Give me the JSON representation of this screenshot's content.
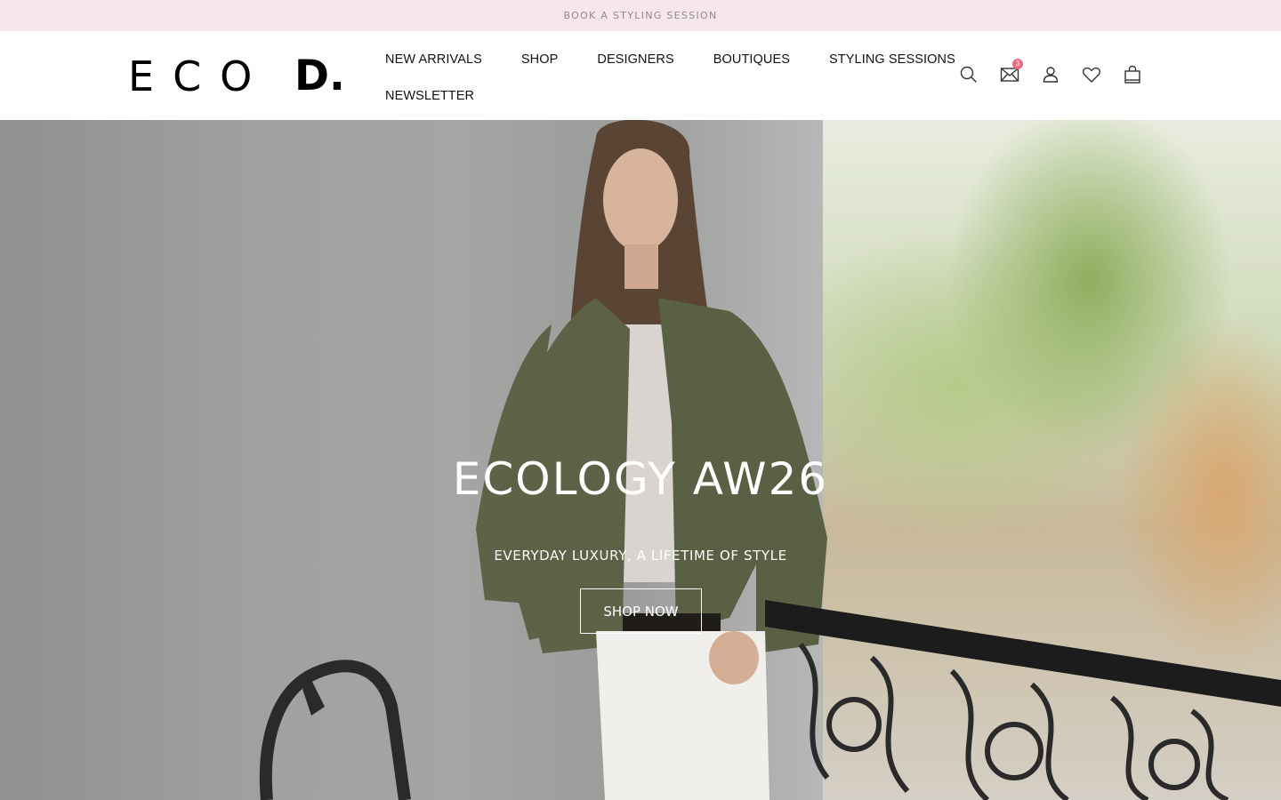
{
  "announcement": {
    "text": "BOOK A STYLING SESSION"
  },
  "brand": {
    "logo_part1": "ECO",
    "logo_part2": "D."
  },
  "nav": {
    "row1": [
      {
        "label": "NEW ARRIVALS"
      },
      {
        "label": "SHOP"
      },
      {
        "label": "DESIGNERS"
      },
      {
        "label": "BOUTIQUES"
      },
      {
        "label": "STYLING SESSIONS"
      }
    ],
    "row2": [
      {
        "label": "NEWSLETTER"
      }
    ]
  },
  "header_icons": {
    "items": [
      "search-icon",
      "mail-icon",
      "account-icon",
      "wishlist-icon",
      "cart-icon"
    ],
    "mail_badge": "3"
  },
  "hero": {
    "title": "ECOLOGY AW26",
    "subtitle": "EVERYDAY LUXURY, A LIFETIME OF STYLE",
    "cta": "SHOP NOW"
  },
  "colors": {
    "announcement_bg": "#f7e6ee",
    "badge": "#e96a86",
    "hero_text": "#ffffff"
  }
}
